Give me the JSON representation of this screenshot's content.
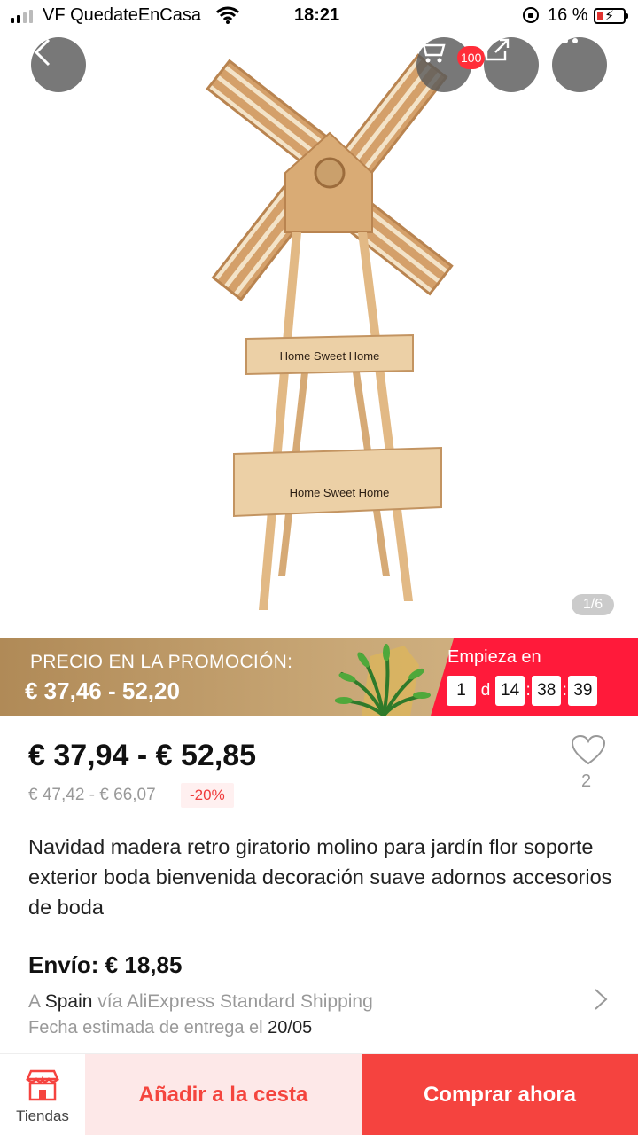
{
  "status_bar": {
    "carrier": "VF QuedateEnCasa",
    "time": "18:21",
    "battery_pct": "16 %"
  },
  "header": {
    "cart_badge": "100",
    "icons": [
      "back-icon",
      "cart-icon",
      "share-icon",
      "more-icon"
    ]
  },
  "gallery": {
    "counter": "1/6",
    "image_signs": [
      "Home Sweet Home",
      "Home Sweet Home"
    ]
  },
  "promo": {
    "label": "PRECIO EN LA PROMOCIÓN:",
    "price": "€ 37,46 - 52,20",
    "starts_label": "Empieza en",
    "countdown": {
      "days": "1",
      "days_unit": "d",
      "hours": "14",
      "minutes": "38",
      "seconds": "39",
      "sep": ":"
    }
  },
  "product": {
    "price": "€ 37,94 - € 52,85",
    "old_price": "€ 47,42 - € 66,07",
    "discount": "-20%",
    "wishlist_count": "2",
    "title": "Navidad madera retro giratorio molino para jardín flor soporte exterior boda bienvenida decoración suave adornos accesorios de boda"
  },
  "shipping": {
    "title": "Envío: € 18,85",
    "to_prefix": "A",
    "country": "Spain",
    "via": "vía AliExpress Standard Shipping",
    "date_prefix": "Fecha estimada de entrega el",
    "date": "20/05"
  },
  "bottom_bar": {
    "store_label": "Tiendas",
    "add_to_cart": "Añadir a la cesta",
    "buy_now": "Comprar ahora"
  },
  "colors": {
    "accent_red": "#f5433f",
    "promo_gold": "#c9a877",
    "countdown_red": "#ff1a3a"
  }
}
